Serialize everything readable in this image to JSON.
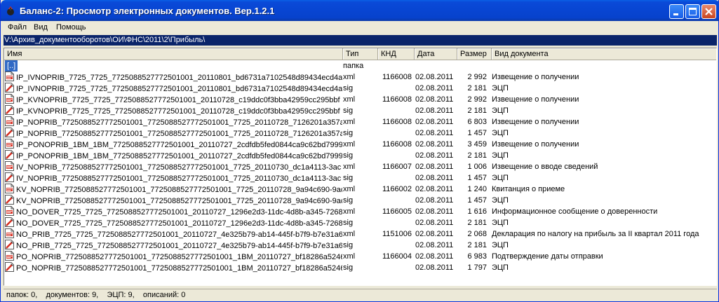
{
  "window": {
    "title": "Баланс-2: Просмотр электронных документов. Вер.1.2.1"
  },
  "menu": {
    "items": [
      "Файл",
      "Вид",
      "Помощь"
    ]
  },
  "path": "V:\\Архив_документооборотов\\ОИ\\ФНС\\2011\\2\\Прибыль\\",
  "columns": [
    "Имя",
    "Тип",
    "КНД",
    "Дата",
    "Размер",
    "Вид документа"
  ],
  "rows": [
    {
      "name": "[..]",
      "type": "папка",
      "knd": "",
      "date": "",
      "size": "",
      "kind": "",
      "icon": "none",
      "selected": true
    },
    {
      "name": "IP_IVNOPRIB_7725_7725_772508852777250100​1_20110801_bd6731a7102548d89434ecd4a",
      "type": "xml",
      "knd": "1166008",
      "date": "02.08.2011",
      "size": "2 992",
      "kind": "Извещение о получении",
      "icon": "xml-file-icon"
    },
    {
      "name": "IP_IVNOPRIB_7725_7725_7725088527772501001_20110801_bd6731a7102548d89434ecd4a",
      "type": "sig",
      "knd": "",
      "date": "02.08.2011",
      "size": "2 181",
      "kind": "ЭЦП",
      "icon": "sig-file-icon"
    },
    {
      "name": "IP_KVNOPRIB_7725_7725_7725088527772501001_20110728_c19ddc0f3bba42959cc295bbf",
      "type": "xml",
      "knd": "1166008",
      "date": "02.08.2011",
      "size": "2 992",
      "kind": "Извещение о получении",
      "icon": "xml-file-icon"
    },
    {
      "name": "IP_KVNOPRIB_7725_7725_7725088527772501001_20110728_c19ddc0f3bba42959cc295bbf",
      "type": "sig",
      "knd": "",
      "date": "02.08.2011",
      "size": "2 181",
      "kind": "ЭЦП",
      "icon": "sig-file-icon"
    },
    {
      "name": "IP_NOPRIB_7725088527772501001_7725088527772501001_7725_20110728_7126201a357a",
      "type": "xml",
      "knd": "1166008",
      "date": "02.08.2011",
      "size": "6 803",
      "kind": "Извещение о получении",
      "icon": "xml-file-icon"
    },
    {
      "name": "IP_NOPRIB_7725088527772501001_7725088527772501001_7725_20110728_7126201a357a",
      "type": "sig",
      "knd": "",
      "date": "02.08.2011",
      "size": "1 457",
      "kind": "ЭЦП",
      "icon": "sig-file-icon"
    },
    {
      "name": "IP_PONOPRIB_1BM_1BM_7725088527772501001_20110727_2cdfdb5fed0844ca9c62bd7999",
      "type": "xml",
      "knd": "1166008",
      "date": "02.08.2011",
      "size": "3 459",
      "kind": "Извещение о получении",
      "icon": "xml-file-icon"
    },
    {
      "name": "IP_PONOPRIB_1BM_1BM_7725088527772501001_20110727_2cdfdb5fed0844ca9c62bd7999",
      "type": "sig",
      "knd": "",
      "date": "02.08.2011",
      "size": "2 181",
      "kind": "ЭЦП",
      "icon": "sig-file-icon"
    },
    {
      "name": "IV_NOPRIB_7725088527772501001_7725088527772501001_7725_20110730_dc1a4113-3ac",
      "type": "xml",
      "knd": "1166007",
      "date": "02.08.2011",
      "size": "1 006",
      "kind": "Извещение о вводе сведений",
      "icon": "xml-file-icon"
    },
    {
      "name": "IV_NOPRIB_7725088527772501001_7725088527772501001_7725_20110730_dc1a4113-3ac",
      "type": "sig",
      "knd": "",
      "date": "02.08.2011",
      "size": "1 457",
      "kind": "ЭЦП",
      "icon": "sig-file-icon"
    },
    {
      "name": "KV_NOPRIB_7725088527772501001_7725088527772501001_7725_20110728_9a94c690-9ac",
      "type": "xml",
      "knd": "1166002",
      "date": "02.08.2011",
      "size": "1 240",
      "kind": "Квитанция о приеме",
      "icon": "xml-file-icon"
    },
    {
      "name": "KV_NOPRIB_7725088527772501001_7725088527772501001_7725_20110728_9a94c690-9ac",
      "type": "sig",
      "knd": "",
      "date": "02.08.2011",
      "size": "1 457",
      "kind": "ЭЦП",
      "icon": "sig-file-icon"
    },
    {
      "name": "NO_DOVER_7725_7725_7725088527772501001_20110727_1296e2d3-11dc-4d8b-a345-7268",
      "type": "xml",
      "knd": "1166005",
      "date": "02.08.2011",
      "size": "1 616",
      "kind": "Информационное сообщение о доверенности",
      "icon": "xml-file-icon"
    },
    {
      "name": "NO_DOVER_7725_7725_7725088527772501001_20110727_1296e2d3-11dc-4d8b-a345-7268",
      "type": "sig",
      "knd": "",
      "date": "02.08.2011",
      "size": "2 181",
      "kind": "ЭЦП",
      "icon": "sig-file-icon"
    },
    {
      "name": "NO_PRIB_7725_7725_7725088527772501001_20110727_4e325b79-ab14-445f-b7f9-b7e31a6",
      "type": "xml",
      "knd": "1151006",
      "date": "02.08.2011",
      "size": "2 068",
      "kind": "Декларация по налогу на прибыль за II квартал 2011 года",
      "icon": "xml-file-icon"
    },
    {
      "name": "NO_PRIB_7725_7725_7725088527772501001_20110727_4e325b79-ab14-445f-b7f9-b7e31a6",
      "type": "sig",
      "knd": "",
      "date": "02.08.2011",
      "size": "2 181",
      "kind": "ЭЦП",
      "icon": "sig-file-icon"
    },
    {
      "name": "PO_NOPRIB_7725088527772501001_7725088527772501001_1BM_20110727_bf18286a5246",
      "type": "xml",
      "knd": "1166004",
      "date": "02.08.2011",
      "size": "6 983",
      "kind": "Подтверждение даты отправки",
      "icon": "xml-file-icon"
    },
    {
      "name": "PO_NOPRIB_7725088527772501001_7725088527772501001_1BM_20110727_bf18286a5246",
      "type": "sig",
      "knd": "",
      "date": "02.08.2011",
      "size": "1 797",
      "kind": "ЭЦП",
      "icon": "sig-file-icon"
    }
  ],
  "status": "папок: 0,    документов: 9,    ЭЦП: 9,    описаний: 0",
  "colors": {
    "title_bar": "#0845d2",
    "selection": "#316ac5",
    "path_bar": "#0a246a",
    "chrome": "#ece9d8"
  }
}
